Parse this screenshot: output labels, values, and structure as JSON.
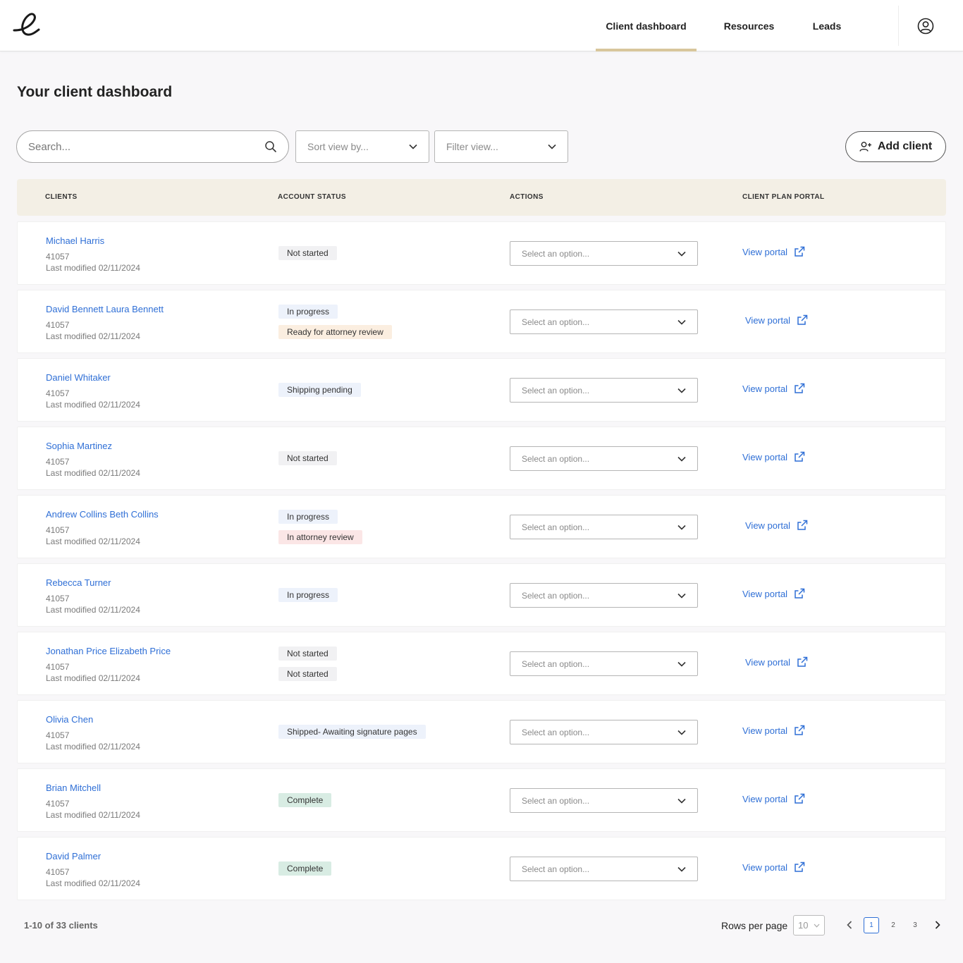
{
  "header": {
    "logo_icon": "script-e-logo",
    "tabs": [
      {
        "label": "Client dashboard",
        "active": true
      },
      {
        "label": "Resources",
        "active": false
      },
      {
        "label": "Leads",
        "active": false
      }
    ],
    "user_icon": "user-circle-icon",
    "accent_color": "#d8c69c"
  },
  "page_title": "Your client dashboard",
  "toolbar": {
    "search_placeholder": "Search...",
    "sort_placeholder": "Sort view by...",
    "filter_placeholder": "Filter view...",
    "add_client_label": "Add client"
  },
  "table": {
    "columns": [
      "CLIENTS",
      "ACCOUNT STATUS",
      "ACTIONS",
      "CLIENT PLAN PORTAL"
    ],
    "action_placeholder": "Select an option...",
    "portal_label": "View portal",
    "rows": [
      {
        "name": "Michael Harris",
        "id": "41057",
        "modified": "Last modified 02/11/2024",
        "statuses": [
          {
            "label": "Not started",
            "tone": "grey"
          }
        ]
      },
      {
        "name": "David Bennett  Laura Bennett",
        "id": "41057",
        "modified": "Last modified 02/11/2024",
        "statuses": [
          {
            "label": "In progress",
            "tone": "blue"
          },
          {
            "label": "Ready for attorney review",
            "tone": "orange"
          }
        ]
      },
      {
        "name": "Daniel Whitaker",
        "id": "41057",
        "modified": "Last modified 02/11/2024",
        "statuses": [
          {
            "label": "Shipping pending",
            "tone": "blue"
          }
        ]
      },
      {
        "name": "Sophia Martinez",
        "id": "41057",
        "modified": "Last modified 02/11/2024",
        "statuses": [
          {
            "label": "Not started",
            "tone": "grey"
          }
        ]
      },
      {
        "name": "Andrew Collins  Beth Collins",
        "id": "41057",
        "modified": "Last modified 02/11/2024",
        "statuses": [
          {
            "label": "In progress",
            "tone": "blue"
          },
          {
            "label": "In attorney review",
            "tone": "red"
          }
        ]
      },
      {
        "name": "Rebecca Turner",
        "id": "41057",
        "modified": "Last modified 02/11/2024",
        "statuses": [
          {
            "label": "In progress",
            "tone": "blue"
          }
        ]
      },
      {
        "name": "Jonathan Price  Elizabeth Price",
        "id": "41057",
        "modified": "Last modified 02/11/2024",
        "statuses": [
          {
            "label": "Not started",
            "tone": "grey"
          },
          {
            "label": "Not started",
            "tone": "grey"
          }
        ]
      },
      {
        "name": "Olivia Chen",
        "id": "41057",
        "modified": "Last modified 02/11/2024",
        "statuses": [
          {
            "label": "Shipped- Awaiting signature pages",
            "tone": "blue"
          }
        ]
      },
      {
        "name": "Brian Mitchell",
        "id": "41057",
        "modified": "Last modified 02/11/2024",
        "statuses": [
          {
            "label": "Complete",
            "tone": "green"
          }
        ]
      },
      {
        "name": "David Palmer",
        "id": "41057",
        "modified": "Last modified 02/11/2024",
        "statuses": [
          {
            "label": "Complete",
            "tone": "green"
          }
        ]
      }
    ]
  },
  "footer": {
    "count_text": "1-10 of 33 clients",
    "rows_per_page_label": "Rows per page",
    "rows_per_page_value": "10",
    "pages": [
      "1",
      "2",
      "3"
    ],
    "current_page": "1"
  }
}
